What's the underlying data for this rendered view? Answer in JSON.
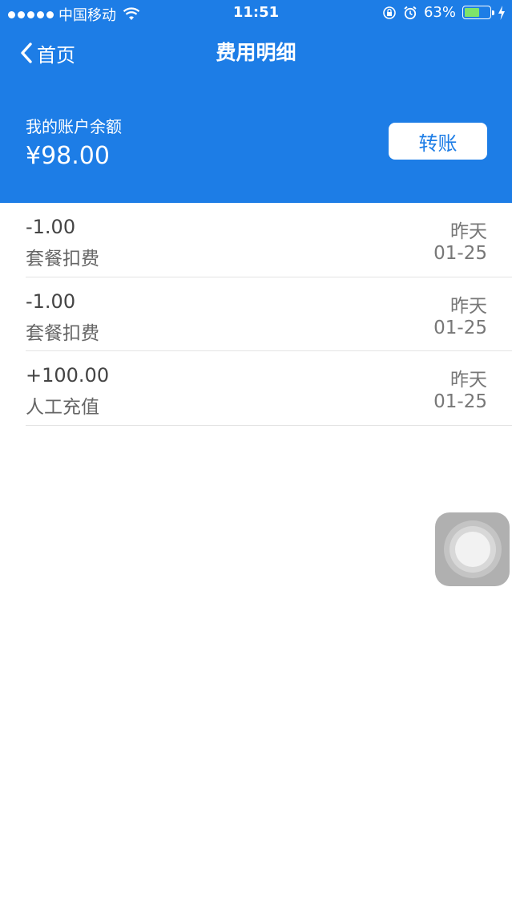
{
  "status_bar": {
    "carrier": "中国移动",
    "time": "11:51",
    "battery_percent": "63%",
    "battery_level": 0.63,
    "icons": [
      "signal-dots-icon",
      "wifi-icon",
      "rotation-lock-icon",
      "alarm-icon",
      "battery-icon",
      "charging-bolt-icon"
    ]
  },
  "nav": {
    "back_label": "首页",
    "title": "费用明细"
  },
  "account": {
    "balance_label": "我的账户余额",
    "balance_value": "¥98.00",
    "transfer_label": "转账"
  },
  "transactions": [
    {
      "amount": "-1.00",
      "description": "套餐扣费",
      "day": "昨天",
      "date": "01-25"
    },
    {
      "amount": "-1.00",
      "description": "套餐扣费",
      "day": "昨天",
      "date": "01-25"
    },
    {
      "amount": "+100.00",
      "description": "人工充值",
      "day": "昨天",
      "date": "01-25"
    }
  ],
  "colors": {
    "header_blue": "#1d7de6",
    "battery_green": "#7ee36a",
    "divider": "#e3e3e3"
  }
}
